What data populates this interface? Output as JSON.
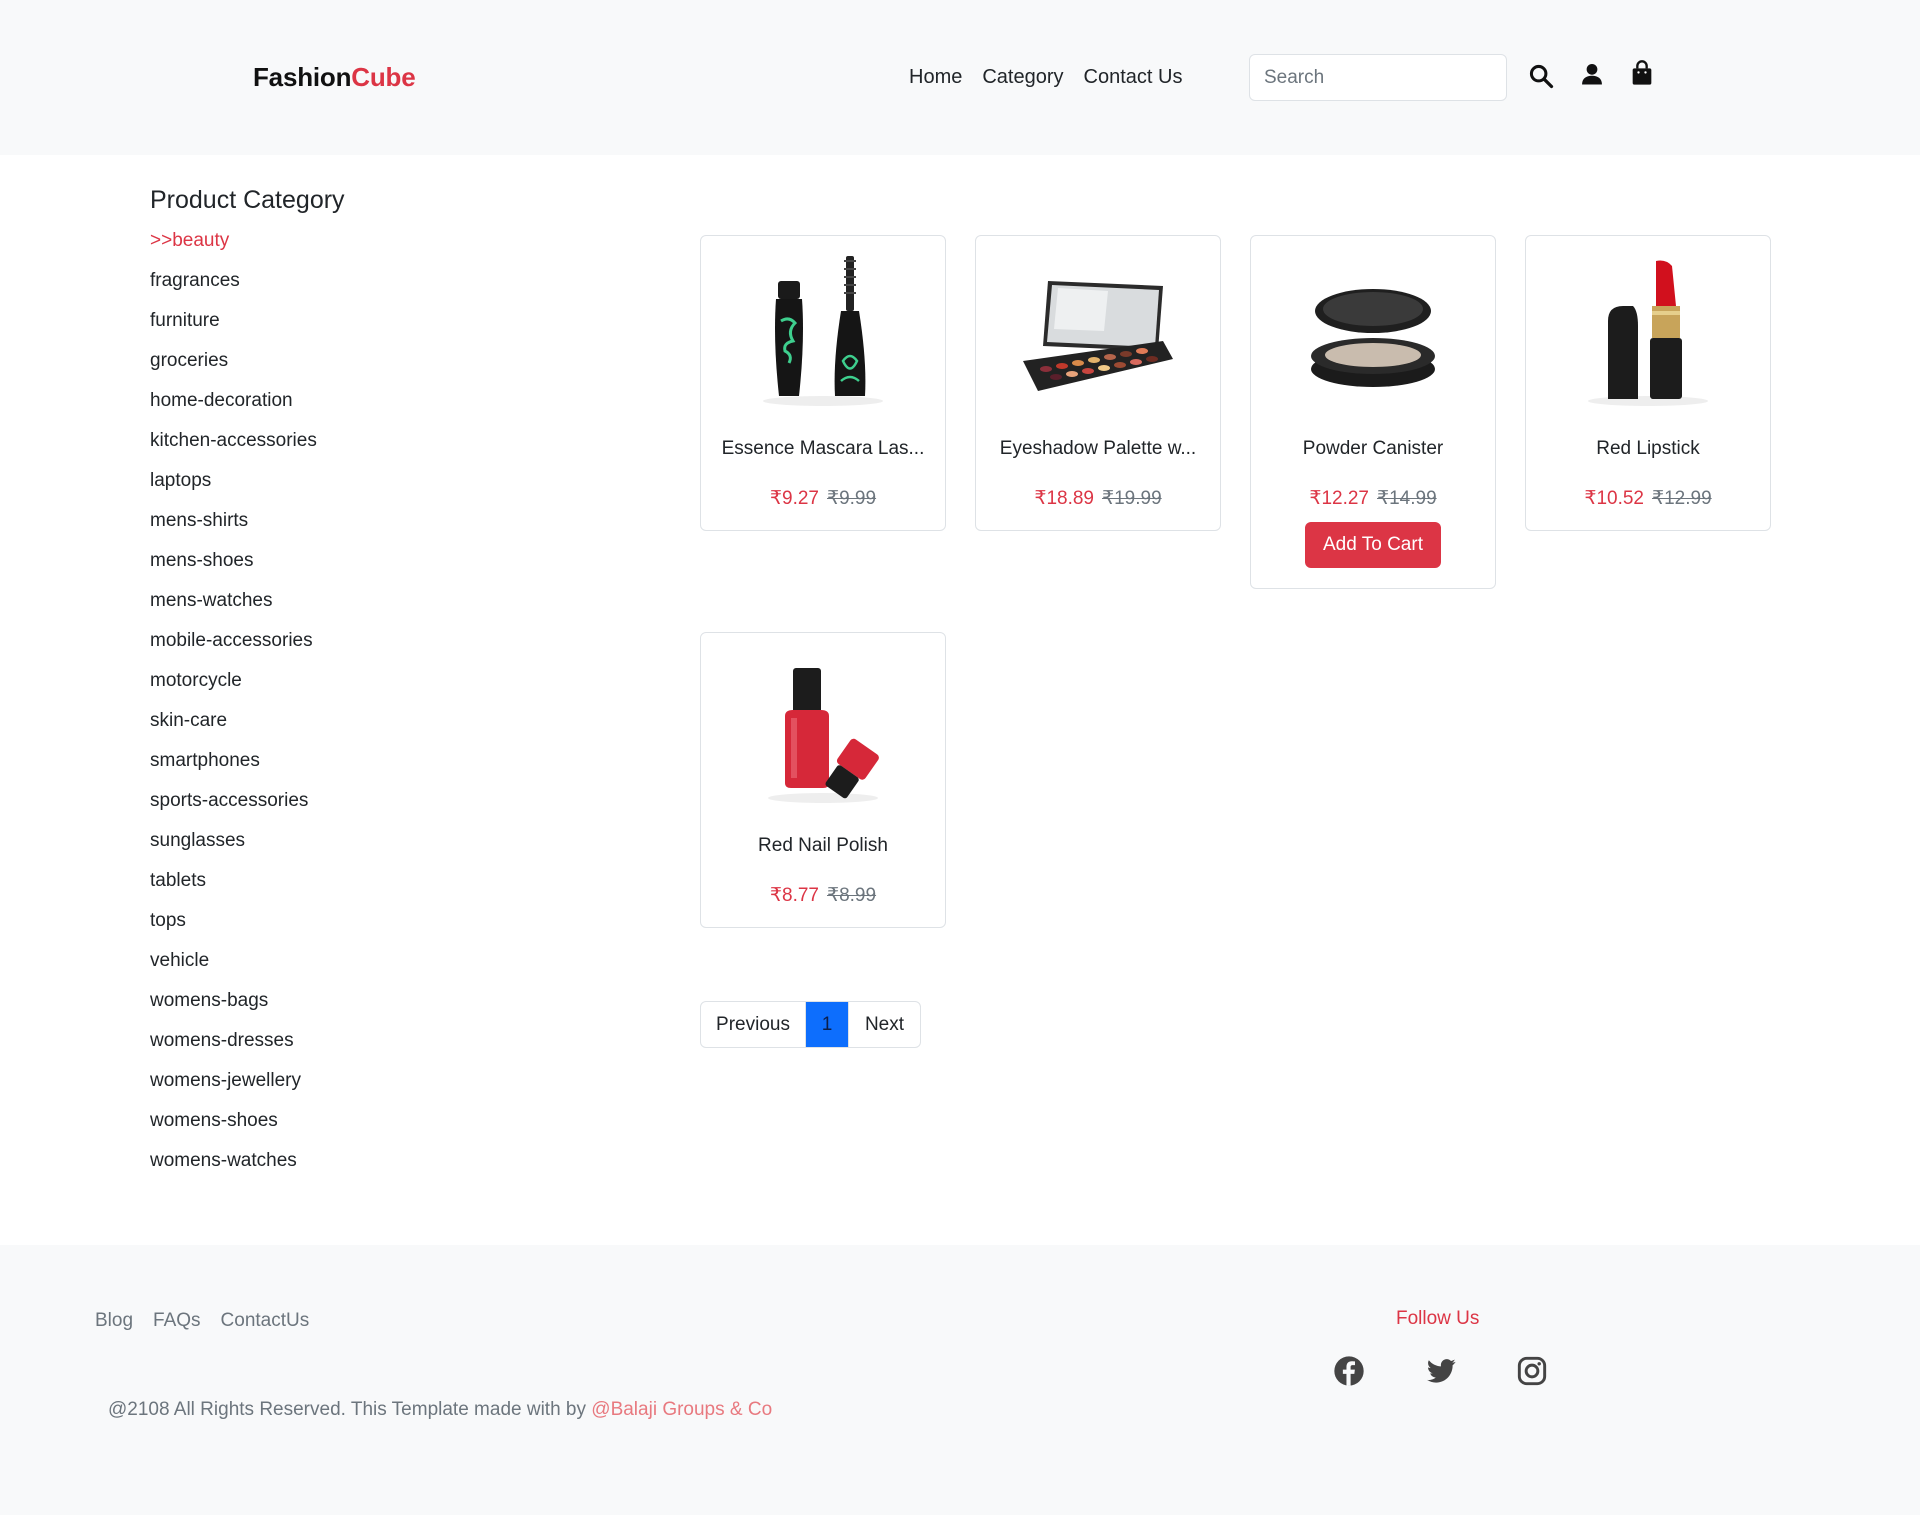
{
  "header": {
    "logo_part1": "Fashion",
    "logo_part2": "Cube",
    "nav": [
      "Home",
      "Category",
      "Contact Us"
    ],
    "search_placeholder": "Search",
    "icons": [
      "search-icon",
      "user-icon",
      "shopping-bag-icon"
    ]
  },
  "sidebar": {
    "title": "Product Category",
    "categories": [
      ">>beauty",
      "fragrances",
      "furniture",
      "groceries",
      "home-decoration",
      "kitchen-accessories",
      "laptops",
      "mens-shirts",
      "mens-shoes",
      "mens-watches",
      "mobile-accessories",
      "motorcycle",
      "skin-care",
      "smartphones",
      "sports-accessories",
      "sunglasses",
      "tablets",
      "tops",
      "vehicle",
      "womens-bags",
      "womens-dresses",
      "womens-jewellery",
      "womens-shoes",
      "womens-watches"
    ],
    "active_index": 0
  },
  "products": [
    {
      "title": "Essence Mascara Las...",
      "price": "₹9.27",
      "old_price": "₹9.99",
      "image": "mascara"
    },
    {
      "title": "Eyeshadow Palette w...",
      "price": "₹18.89",
      "old_price": "₹19.99",
      "image": "eyeshadow-palette"
    },
    {
      "title": "Powder Canister",
      "price": "₹12.27",
      "old_price": "₹14.99",
      "image": "powder-canister",
      "button": "Add To Cart"
    },
    {
      "title": "Red Lipstick",
      "price": "₹10.52",
      "old_price": "₹12.99",
      "image": "lipstick"
    },
    {
      "title": "Red Nail Polish",
      "price": "₹8.77",
      "old_price": "₹8.99",
      "image": "nail-polish"
    }
  ],
  "pagination": {
    "previous": "Previous",
    "current": "1",
    "next": "Next"
  },
  "footer": {
    "links": [
      "Blog",
      "FAQs",
      "ContactUs"
    ],
    "follow_title": "Follow Us",
    "social": [
      "facebook-icon",
      "twitter-icon",
      "instagram-icon"
    ],
    "copyright_text": "@2108 All Rights Reserved. This Template made with by ",
    "copyright_brand": "@Balaji Groups & Co"
  },
  "colors": {
    "accent": "#dc3545",
    "primary": "#0d6efd",
    "muted": "#6c757d"
  }
}
